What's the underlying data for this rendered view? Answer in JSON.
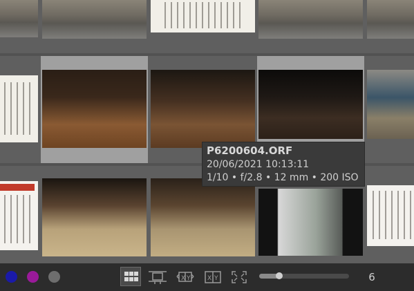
{
  "tooltip": {
    "filename": "P6200604.ORF",
    "datetime": "20/06/2021 10:13:11",
    "exif": "1/10 • f/2.8 • 12 mm • 200 ISO"
  },
  "toolbar": {
    "color_labels": [
      {
        "name": "blue",
        "color": "#1a1aa8"
      },
      {
        "name": "purple",
        "color": "#9a1a9a"
      },
      {
        "name": "gray",
        "color": "#6e6e6e"
      }
    ],
    "layout_buttons": [
      {
        "name": "filemanager",
        "icon": "grid-icon",
        "active": true
      },
      {
        "name": "zoomable-lighttable",
        "icon": "zoomable-lighttable-icon",
        "active": false
      },
      {
        "name": "culling-fixed",
        "icon": "culling-fixed-icon",
        "active": false
      },
      {
        "name": "culling-dynamic",
        "icon": "culling-dynamic-icon",
        "active": false
      },
      {
        "name": "preview",
        "icon": "fullscreen-preview-icon",
        "active": false
      }
    ],
    "zoom_level": 0.22,
    "columns_value": "6"
  },
  "grid": {
    "selected_tile": "P6200604.ORF"
  }
}
